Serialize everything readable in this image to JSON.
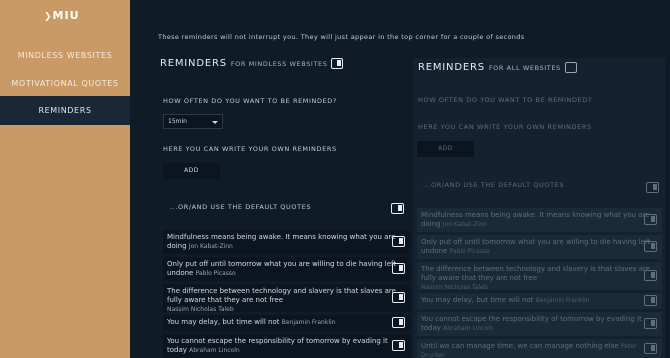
{
  "sidebar": {
    "logo": "MIU",
    "items": [
      {
        "label": "MINDLESS WEBSITES"
      },
      {
        "label": "MOTIVATIONAL QUOTES"
      },
      {
        "label": "REMINDERS"
      }
    ]
  },
  "notice": "These reminders will not interrupt you. They will just appear in the top corner for a couple of seconds",
  "left": {
    "title": "REMINDERS",
    "subtitle": "FOR MINDLESS WEBSITES",
    "how_often": "HOW OFTEN DO YOU WANT TO BE REMINDED?",
    "frequency_value": "15min",
    "write_own": "HERE YOU CAN WRITE YOUR OWN REMINDERS",
    "add_label": "ADD",
    "default_quotes": "...OR/AND USE THE DEFAULT QUOTES",
    "quotes": [
      {
        "text": "Mindfulness means being awake. It means knowing what you are doing",
        "author": "Jon Kabat-Zinn"
      },
      {
        "text": "Only put off until tomorrow what you are willing to die having left undone",
        "author": "Pablo Picasso"
      },
      {
        "text": "The difference between technology and slavery is that slaves are fully aware that they are not free",
        "author": "Nassim Nicholas Taleb"
      },
      {
        "text": "You may delay, but time will not",
        "author": "Benjamin Franklin"
      },
      {
        "text": "You cannot escape the responsibility of tomorrow by evading it today",
        "author": "Abraham Lincoln"
      }
    ]
  },
  "right": {
    "title": "REMINDERS",
    "subtitle": "FOR ALL WEBSITES",
    "how_often": "HOW OFTEN DO YOU WANT TO BE REMINDED?",
    "write_own": "HERE YOU CAN WRITE YOUR OWN REMINDERS",
    "add_label": "ADD",
    "default_quotes": "...OR/AND USE THE DEFAULT QUOTES",
    "quotes": [
      {
        "text": "Mindfulness means being awake. It means knowing what you are doing",
        "author": "Jon Kabat-Zinn"
      },
      {
        "text": "Only put off until tomorrow what you are willing to die having left undone",
        "author": "Pablo Picasso"
      },
      {
        "text": "The difference between technology and slavery is that slaves are fully aware that they are not free",
        "author": "Nassim Nicholas Taleb"
      },
      {
        "text": "You may delay, but time will not",
        "author": "Benjamin Franklin"
      },
      {
        "text": "You cannot escape the responsibility of tomorrow by evading it today",
        "author": "Abraham Lincoln"
      },
      {
        "text": "Until we can manage time, we can manage nothing else",
        "author": "Peter Drucker"
      }
    ]
  },
  "colors": {
    "sidebar": "#c99a66",
    "background": "#0f1b27",
    "active_nav": "#1a2836"
  }
}
